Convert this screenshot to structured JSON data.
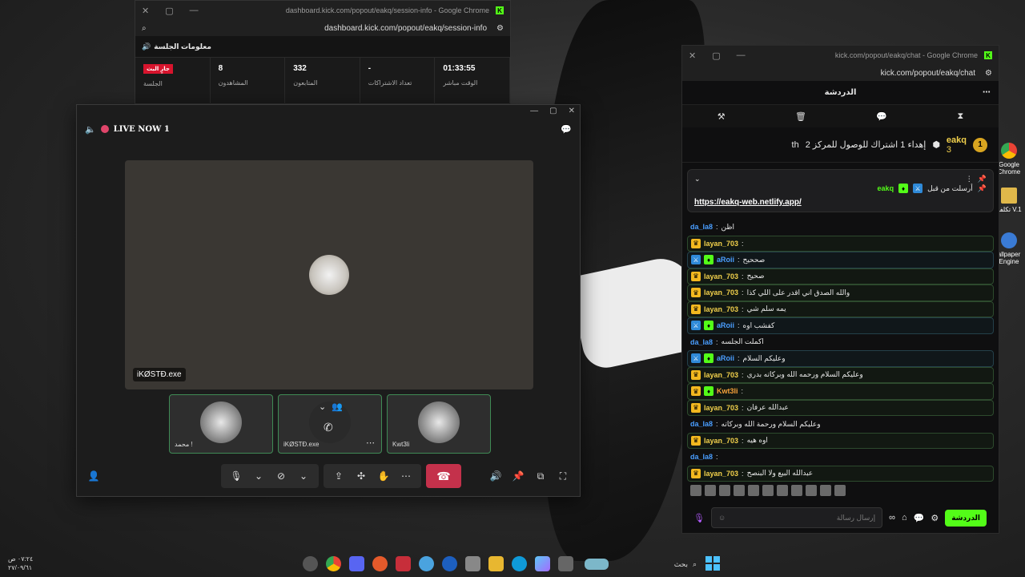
{
  "dashboard_window": {
    "title": "dashboard.kick.com/popout/eakq/session-info - Google Chrome",
    "url": "dashboard.kick.com/popout/eakq/session-info",
    "header": "معلومات الجلسة",
    "live_badge": "جارٍ البث",
    "stats": [
      {
        "value": "",
        "label": "الجلسة"
      },
      {
        "value": "8",
        "label": "المشاهدون"
      },
      {
        "value": "332",
        "label": "المتابعون"
      },
      {
        "value": "-",
        "label": "تعداد الاشتراكات"
      },
      {
        "value": "01:33:55",
        "label": "الوقت مباشر"
      }
    ]
  },
  "call_window": {
    "title": "LIVE NOW 1",
    "main_speaker": "iKØSTÐ.exe",
    "participants": [
      {
        "name": "محمد !"
      },
      {
        "name": "iKØSTÐ.exe"
      },
      {
        "name": "Kwt3li"
      }
    ],
    "colors": {
      "hangup": "#c4314b",
      "active_border": "#3f8a55"
    }
  },
  "chat_window": {
    "title": "kick.com/popout/eakq/chat - Google Chrome",
    "url": "kick.com/popout/eakq/chat",
    "header": "الدردشة",
    "leader": {
      "rank": "1",
      "name": "eakq",
      "count": "3",
      "goal_text": "إهداء 1 اشتراك للوصول للمركز 2",
      "suffix": "th"
    },
    "pinned": {
      "user": "eakq",
      "sent_by_label": "أرسلت من قبل",
      "link": "https://eakq-web.netlify.app/"
    },
    "messages": [
      {
        "user": "da_la8",
        "text": "اظن",
        "color": "#4a9eff",
        "style": "plain",
        "badges": []
      },
      {
        "user": "layan_703",
        "text": "",
        "color": "#f2d14c",
        "style": "boxed",
        "badges": [
          "crown"
        ]
      },
      {
        "user": "aRoii",
        "text": "صححيح",
        "color": "#4a9eff",
        "style": "boxed-blue",
        "badges": [
          "mod",
          "vip"
        ]
      },
      {
        "user": "layan_703",
        "text": "صحيح",
        "color": "#f2d14c",
        "style": "boxed",
        "badges": [
          "crown"
        ]
      },
      {
        "user": "layan_703",
        "text": "والله الصدق اني اقدر على اللي كذا",
        "color": "#f2d14c",
        "style": "boxed",
        "badges": [
          "crown"
        ]
      },
      {
        "user": "layan_703",
        "text": "يمه سلم شي",
        "color": "#f2d14c",
        "style": "boxed",
        "badges": [
          "crown"
        ]
      },
      {
        "user": "aRoii",
        "text": "كفشب اوه",
        "color": "#4a9eff",
        "style": "boxed-blue",
        "badges": [
          "mod",
          "vip"
        ]
      },
      {
        "user": "da_la8",
        "text": "اكملت الجلسه",
        "color": "#4a9eff",
        "style": "plain",
        "badges": []
      },
      {
        "user": "aRoii",
        "text": "وعليكم السلام",
        "color": "#4a9eff",
        "style": "boxed-blue",
        "badges": [
          "mod",
          "vip"
        ]
      },
      {
        "user": "layan_703",
        "text": "وعليكم السلام ورحمه الله وبركاته بدري",
        "color": "#f2d14c",
        "style": "boxed",
        "badges": [
          "crown"
        ]
      },
      {
        "user": "Kwt3li",
        "text": "",
        "color": "#f7a23a",
        "style": "boxed",
        "badges": [
          "crown",
          "vip"
        ]
      },
      {
        "user": "layan_703",
        "text": "عبدالله عرفان",
        "color": "#f2d14c",
        "style": "boxed",
        "badges": [
          "crown"
        ]
      },
      {
        "user": "da_la8",
        "text": "وعليكم السلام ورحمة الله وبركاته",
        "color": "#4a9eff",
        "style": "plain",
        "badges": []
      },
      {
        "user": "layan_703",
        "text": "اوه هيه",
        "color": "#f2d14c",
        "style": "boxed",
        "badges": [
          "crown"
        ]
      },
      {
        "user": "da_la8",
        "text": "",
        "color": "#4a9eff",
        "style": "plain",
        "badges": []
      },
      {
        "user": "layan_703",
        "text": "عبدالله البيع ولا البنصح",
        "color": "#f2d14c",
        "style": "boxed",
        "badges": [
          "crown"
        ]
      }
    ],
    "input_placeholder": "إرسال رسالة",
    "send_label": "الدردشة"
  },
  "taskbar": {
    "time": "٠٧:٢٤ ص",
    "date": "٢٧/٠٩/٦١",
    "search_label": "بحث"
  },
  "desktop_icons": [
    {
      "label": "Google Chrome",
      "color": "#4285f4"
    },
    {
      "label": "تكلفة V.1",
      "color": "#e0b84a"
    },
    {
      "label": "allpaper Engine",
      "color": "#3a7bd5"
    }
  ]
}
